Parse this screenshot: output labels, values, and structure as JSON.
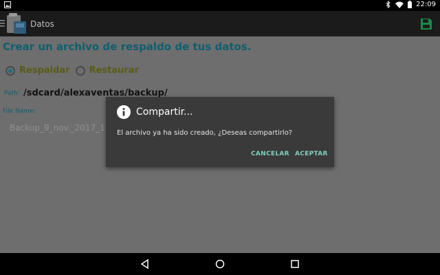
{
  "status_bar": {
    "time": "22:09",
    "icons": [
      "image-icon",
      "bluetooth-icon",
      "wifi-icon",
      "battery-icon"
    ]
  },
  "app_bar": {
    "title": "Datos",
    "icons": [
      "menu-icon",
      "app-logo-icon",
      "save-icon"
    ],
    "accent": "#1a8a4a"
  },
  "content": {
    "heading": "Crear un archivo de respaldo de tus datos.",
    "radio_backup": "Respaldar",
    "radio_restore": "Restaurar",
    "path_label": "Path:",
    "path_value": "/sdcard/alexaventas/backup/",
    "file_label": "File Name:",
    "file_value": "Backup_9_nov._2017_1"
  },
  "dialog": {
    "title": "Compartir...",
    "message": "El archivo ya ha sido creado, ¿Deseas compartirlo?",
    "cancel": "CANCELAR",
    "accept": "ACEPTAR",
    "icon": "info-icon",
    "button_color": "#7fcfbe"
  },
  "nav_bar": {
    "icons": [
      "back-icon",
      "home-icon",
      "recents-icon"
    ]
  }
}
